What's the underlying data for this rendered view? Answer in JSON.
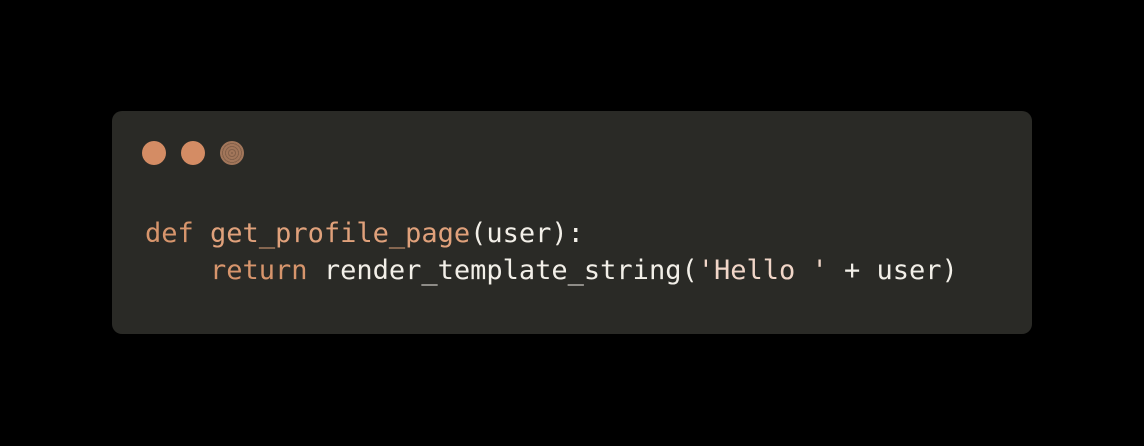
{
  "window": {
    "controls": [
      {
        "name": "close",
        "color": "#d48c64"
      },
      {
        "name": "minimize",
        "color": "#d48c64"
      },
      {
        "name": "zoom",
        "color": "#a2765a"
      }
    ]
  },
  "code": {
    "language": "python",
    "lines": [
      {
        "tokens": [
          {
            "type": "keyword",
            "text": "def"
          },
          {
            "type": "plain",
            "text": " "
          },
          {
            "type": "function",
            "text": "get_profile_page"
          },
          {
            "type": "plain",
            "text": "(user):"
          }
        ]
      },
      {
        "tokens": [
          {
            "type": "plain",
            "text": "    "
          },
          {
            "type": "keyword",
            "text": "return"
          },
          {
            "type": "plain",
            "text": " render_template_string("
          },
          {
            "type": "string",
            "text": "'Hello '"
          },
          {
            "type": "plain",
            "text": " + user)"
          }
        ]
      }
    ]
  },
  "colors": {
    "background": "#000000",
    "panel": "#2a2a26",
    "keyword": "#d7956c",
    "function": "#e0a17b",
    "text": "#f2efe8"
  }
}
